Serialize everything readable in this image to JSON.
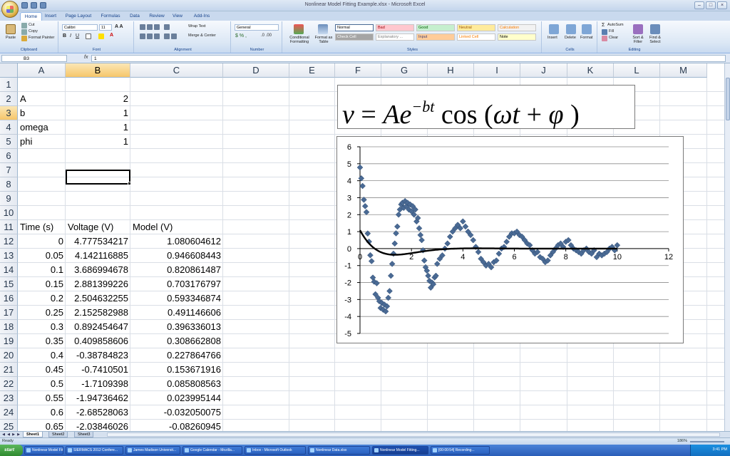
{
  "window": {
    "title": "Nonlinear Model Fitting Example.xlsx - Microsoft Excel"
  },
  "ribbon_tabs": [
    "Home",
    "Insert",
    "Page Layout",
    "Formulas",
    "Data",
    "Review",
    "View",
    "Add-Ins"
  ],
  "ribbon": {
    "clipboard": {
      "paste": "Paste",
      "cut": "Cut",
      "copy": "Copy",
      "format_painter": "Format Painter",
      "label": "Clipboard"
    },
    "font": {
      "name": "Calibri",
      "size": "11",
      "label": "Font"
    },
    "alignment": {
      "wrap": "Wrap Text",
      "merge": "Merge & Center",
      "label": "Alignment"
    },
    "number": {
      "format": "General",
      "label": "Number"
    },
    "styles": {
      "conditional": "Conditional Formatting",
      "format_table": "Format as Table",
      "cells": [
        {
          "label": "Normal",
          "bg": "#ffffff",
          "fg": "#000000"
        },
        {
          "label": "Bad",
          "bg": "#ffc7ce",
          "fg": "#9c0006"
        },
        {
          "label": "Good",
          "bg": "#c6efce",
          "fg": "#006100"
        },
        {
          "label": "Neutral",
          "bg": "#ffeb9c",
          "fg": "#9c5700"
        },
        {
          "label": "Calculation",
          "bg": "#f2f2f2",
          "fg": "#fa7d00"
        },
        {
          "label": "Check Cell",
          "bg": "#a5a5a5",
          "fg": "#ffffff"
        },
        {
          "label": "Explanatory ...",
          "bg": "#ffffff",
          "fg": "#7f7f7f"
        },
        {
          "label": "Input",
          "bg": "#ffcc99",
          "fg": "#3f3f76"
        },
        {
          "label": "Linked Cell",
          "bg": "#ffffff",
          "fg": "#fa7d00"
        },
        {
          "label": "Note",
          "bg": "#ffffcc",
          "fg": "#000000"
        }
      ],
      "label": "Styles"
    },
    "cells": {
      "insert": "Insert",
      "delete": "Delete",
      "format": "Format",
      "label": "Cells"
    },
    "editing": {
      "autosum": "AutoSum",
      "fill": "Fill",
      "clear": "Clear",
      "sort": "Sort & Filter",
      "find": "Find & Select",
      "label": "Editing"
    }
  },
  "formula_bar": {
    "name_box": "B3",
    "fx": "fx",
    "content": "1"
  },
  "columns": [
    "A",
    "B",
    "C",
    "D",
    "E",
    "F",
    "G",
    "H",
    "I",
    "J",
    "K",
    "L",
    "M"
  ],
  "rows": [
    "1",
    "2",
    "3",
    "4",
    "5",
    "6",
    "7",
    "8",
    "9",
    "10",
    "11",
    "12",
    "13",
    "14",
    "15",
    "16",
    "17",
    "18",
    "19",
    "20",
    "21",
    "22",
    "23",
    "24",
    "25"
  ],
  "cells": {
    "params": [
      {
        "name": "A",
        "value": "2"
      },
      {
        "name": "b",
        "value": "1"
      },
      {
        "name": "omega",
        "value": "1"
      },
      {
        "name": "phi",
        "value": "1"
      }
    ],
    "headers": {
      "time": "Time (s)",
      "voltage": "Voltage (V)",
      "model": "Model (V)"
    },
    "data": [
      [
        "0",
        "4.777534217",
        "1.080604612"
      ],
      [
        "0.05",
        "4.142116885",
        "0.946608443"
      ],
      [
        "0.1",
        "3.686994678",
        "0.820861487"
      ],
      [
        "0.15",
        "2.881399226",
        "0.703176797"
      ],
      [
        "0.2",
        "2.504632255",
        "0.593346874"
      ],
      [
        "0.25",
        "2.152582988",
        "0.491146606"
      ],
      [
        "0.3",
        "0.892454647",
        "0.396336013"
      ],
      [
        "0.35",
        "0.409858606",
        "0.308662808"
      ],
      [
        "0.4",
        "-0.38784823",
        "0.227864766"
      ],
      [
        "0.45",
        "-0.7410501",
        "0.153671916"
      ],
      [
        "0.5",
        "-1.7109398",
        "0.085808563"
      ],
      [
        "0.55",
        "-1.94736462",
        "0.023995144"
      ],
      [
        "0.6",
        "-2.68528063",
        "-0.032050075"
      ],
      [
        "0.65",
        "-2.03846026",
        "-0.08260945"
      ]
    ]
  },
  "equation": {
    "v": "v",
    "eq": "=",
    "A": "A",
    "e": "e",
    "exp": "−bt",
    "cos": "cos",
    "open": "(",
    "omega": "ω",
    "t": "t",
    "plus": "+",
    "phi": "φ",
    "close": ")"
  },
  "chart_data": {
    "type": "scatter",
    "title": "",
    "xlabel": "",
    "ylabel": "",
    "xlim": [
      0,
      12
    ],
    "ylim": [
      -5,
      6
    ],
    "x_ticks": [
      0,
      2,
      4,
      6,
      8,
      10,
      12
    ],
    "y_ticks": [
      6,
      5,
      4,
      3,
      2,
      1,
      0,
      -1,
      -2,
      -3,
      -4,
      -5
    ],
    "grid": "horizontal",
    "series": [
      {
        "kind": "scatter",
        "color": "#4a6a94",
        "x": [
          0,
          0.05,
          0.1,
          0.15,
          0.2,
          0.25,
          0.3,
          0.35,
          0.4,
          0.45,
          0.5,
          0.55,
          0.6,
          0.65,
          0.7,
          0.75,
          0.8,
          0.85,
          0.9,
          0.95,
          1.0,
          1.05,
          1.1,
          1.15,
          1.2,
          1.25,
          1.3,
          1.35,
          1.4,
          1.45,
          1.5,
          1.55,
          1.6,
          1.65,
          1.7,
          1.75,
          1.8,
          1.85,
          1.9,
          1.95,
          2.0,
          2.05,
          2.1,
          2.15,
          2.2,
          2.25,
          2.3,
          2.35,
          2.4,
          2.45,
          2.5,
          2.55,
          2.6,
          2.65,
          2.7,
          2.75,
          2.8,
          2.85,
          2.9,
          2.95,
          3.0,
          3.1,
          3.2,
          3.3,
          3.4,
          3.5,
          3.6,
          3.7,
          3.8,
          3.9,
          4.0,
          4.1,
          4.2,
          4.3,
          4.4,
          4.5,
          4.6,
          4.7,
          4.8,
          4.9,
          5.0,
          5.1,
          5.2,
          5.3,
          5.4,
          5.5,
          5.6,
          5.7,
          5.8,
          5.9,
          6.0,
          6.1,
          6.2,
          6.3,
          6.4,
          6.5,
          6.6,
          6.7,
          6.8,
          6.9,
          7.0,
          7.1,
          7.2,
          7.3,
          7.4,
          7.5,
          7.6,
          7.7,
          7.8,
          7.9,
          8.0,
          8.1,
          8.2,
          8.3,
          8.4,
          8.5,
          8.6,
          8.7,
          8.8,
          8.9,
          9.0,
          9.1,
          9.2,
          9.3,
          9.4,
          9.5,
          9.6,
          9.7,
          9.8,
          9.9,
          10.0
        ],
        "y": [
          4.78,
          4.14,
          3.69,
          2.88,
          2.5,
          2.15,
          0.89,
          0.41,
          -0.39,
          -0.74,
          -1.71,
          -1.95,
          -2.69,
          -2.04,
          -2.9,
          -3.1,
          -3.5,
          -3.2,
          -3.6,
          -3.3,
          -3.7,
          -3.4,
          -2.9,
          -2.5,
          -1.6,
          -0.9,
          -0.3,
          0.3,
          0.9,
          1.3,
          2.0,
          2.3,
          2.6,
          2.7,
          2.4,
          2.8,
          2.5,
          2.7,
          2.3,
          2.6,
          2.2,
          2.5,
          2.0,
          2.3,
          1.6,
          1.8,
          1.2,
          0.8,
          0.5,
          -0.1,
          -0.7,
          -1.1,
          -1.3,
          -1.6,
          -1.9,
          -2.3,
          -2.0,
          -2.1,
          -1.7,
          -1.6,
          -0.9,
          -0.6,
          -0.4,
          0.0,
          0.3,
          0.7,
          1.0,
          1.2,
          1.4,
          1.2,
          1.6,
          1.3,
          1.0,
          0.8,
          0.5,
          0.1,
          -0.2,
          -0.6,
          -0.8,
          -1.0,
          -0.9,
          -1.1,
          -0.8,
          -0.7,
          -0.3,
          0.0,
          0.1,
          0.4,
          0.7,
          0.9,
          0.9,
          1.0,
          0.8,
          0.7,
          0.5,
          0.3,
          0.2,
          -0.1,
          -0.3,
          -0.2,
          -0.5,
          -0.6,
          -0.8,
          -0.7,
          -0.4,
          -0.2,
          0.0,
          0.2,
          0.3,
          0.1,
          0.4,
          0.5,
          0.2,
          0.0,
          -0.1,
          -0.2,
          -0.3,
          -0.1,
          0.0,
          -0.2,
          -0.3,
          -0.1,
          -0.5,
          -0.3,
          -0.4,
          -0.3,
          -0.2,
          0.0,
          0.1,
          -0.1,
          0.2
        ]
      },
      {
        "kind": "line",
        "color": "#000000",
        "expr": "2*exp(-t)*cos(t+1)"
      }
    ]
  },
  "sheets": [
    "Sheet1",
    "Sheet2",
    "Sheet3"
  ],
  "status": {
    "text": "Ready",
    "zoom": "186%"
  },
  "taskbar": {
    "start": "start",
    "items": [
      "Nonlinear Model Fitting w...",
      "SIERMACS 2012 Confere...",
      "James Madison Universit...",
      "Google Calendar - Mozilla...",
      "Inbox - Microsoft Outlook",
      "Nonlinear Data.xlsx",
      "Nonlinear Model Fitting...",
      "[00:00:54] Recording..."
    ],
    "clock": "3:41 PM"
  }
}
